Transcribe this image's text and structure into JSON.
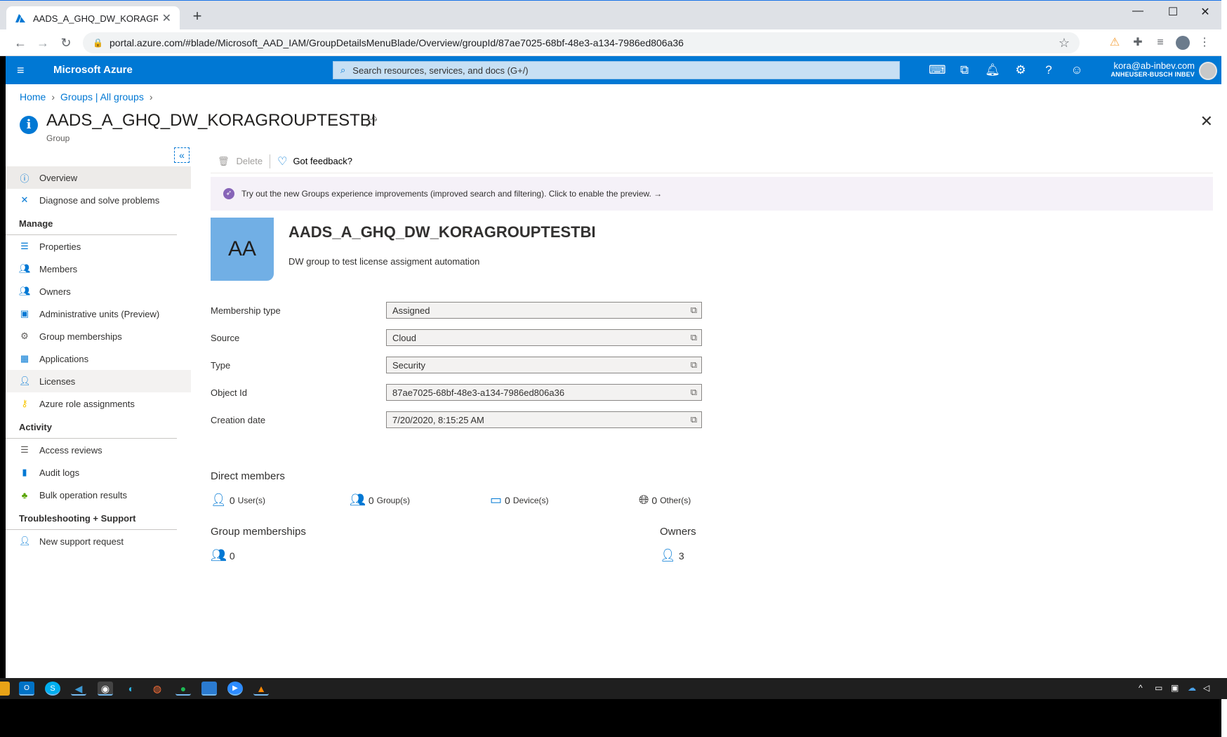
{
  "browser": {
    "tab_title": "AADS_A_GHQ_DW_KORAGROUP",
    "tab_close": "✕",
    "new_tab": "+",
    "url": "portal.azure.com/#blade/Microsoft_AAD_IAM/GroupDetailsMenuBlade/Overview/groupId/87ae7025-68bf-48e3-a134-7986ed806a36"
  },
  "azure_header": {
    "brand": "Microsoft Azure",
    "search_placeholder": "Search resources, services, and docs (G+/)",
    "account_email": "kora@ab-inbev.com",
    "account_org": "ANHEUSER-BUSCH INBEV"
  },
  "breadcrumb": [
    "Home",
    "Groups | All groups"
  ],
  "page": {
    "title": "AADS_A_GHQ_DW_KORAGROUPTESTBI",
    "subtitle": "Group"
  },
  "nav": {
    "top_items": [
      {
        "label": "Overview",
        "icon": "info-icon"
      },
      {
        "label": "Diagnose and solve problems",
        "icon": "wrench-icon"
      }
    ],
    "sections": [
      {
        "header": "Manage",
        "items": [
          {
            "label": "Properties",
            "icon": "properties-icon"
          },
          {
            "label": "Members",
            "icon": "members-icon"
          },
          {
            "label": "Owners",
            "icon": "owners-icon"
          },
          {
            "label": "Administrative units (Preview)",
            "icon": "admin-units-icon"
          },
          {
            "label": "Group memberships",
            "icon": "gear-icon"
          },
          {
            "label": "Applications",
            "icon": "apps-grid-icon"
          },
          {
            "label": "Licenses",
            "icon": "licenses-icon"
          },
          {
            "label": "Azure role assignments",
            "icon": "key-icon"
          }
        ]
      },
      {
        "header": "Activity",
        "items": [
          {
            "label": "Access reviews",
            "icon": "list-icon"
          },
          {
            "label": "Audit logs",
            "icon": "book-icon"
          },
          {
            "label": "Bulk operation results",
            "icon": "bulk-icon"
          }
        ]
      },
      {
        "header": "Troubleshooting + Support",
        "items": [
          {
            "label": "New support request",
            "icon": "support-person-icon"
          }
        ]
      }
    ]
  },
  "toolbar": {
    "delete_label": "Delete",
    "feedback_label": "Got feedback?"
  },
  "banner": {
    "text": "Try out the new Groups experience improvements (improved search and filtering). Click to enable the preview. →"
  },
  "group": {
    "initials": "AA",
    "name": "AADS_A_GHQ_DW_KORAGROUPTESTBI",
    "description": "DW group to test license assigment automation",
    "properties": [
      {
        "label": "Membership type",
        "value": "Assigned"
      },
      {
        "label": "Source",
        "value": "Cloud"
      },
      {
        "label": "Type",
        "value": "Security"
      },
      {
        "label": "Object Id",
        "value": "87ae7025-68bf-48e3-a134-7986ed806a36"
      },
      {
        "label": "Creation date",
        "value": "7/20/2020, 8:15:25 AM"
      }
    ]
  },
  "direct_members": {
    "header": "Direct members",
    "users": {
      "count": "0",
      "label": "User(s)"
    },
    "groups": {
      "count": "0",
      "label": "Group(s)"
    },
    "devices": {
      "count": "0",
      "label": "Device(s)"
    },
    "others": {
      "count": "0",
      "label": "Other(s)"
    }
  },
  "group_memberships": {
    "header": "Group memberships",
    "count": "0"
  },
  "owners": {
    "header": "Owners",
    "count": "3"
  }
}
